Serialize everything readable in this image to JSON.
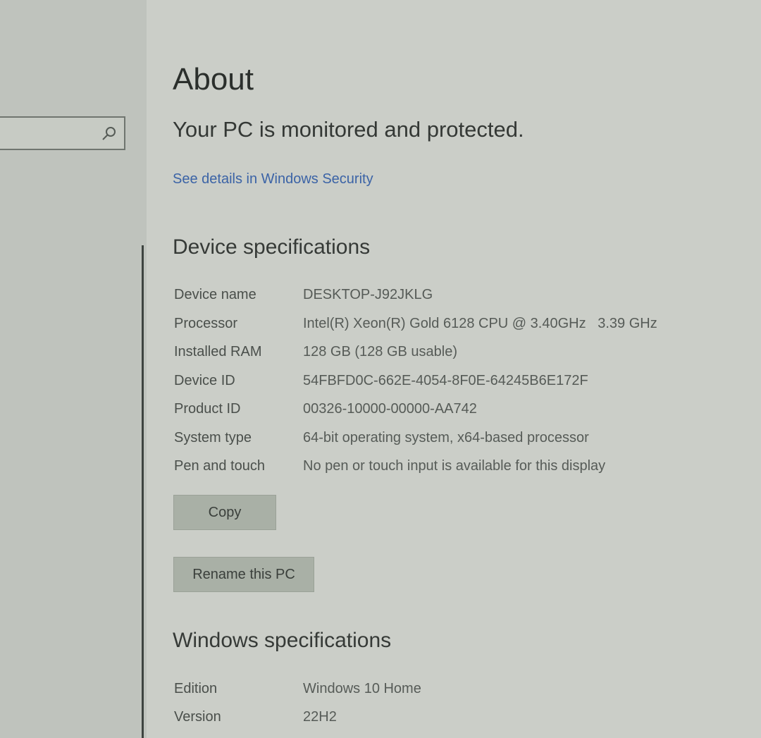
{
  "sidebar": {
    "search": {
      "value": "",
      "placeholder": ""
    }
  },
  "main": {
    "title": "About",
    "protection": {
      "status": "Your PC is monitored and protected.",
      "link": "See details in Windows Security"
    },
    "device_specs": {
      "heading": "Device specifications",
      "rows": [
        {
          "label": "Device name",
          "value": "DESKTOP-J92JKLG"
        },
        {
          "label": "Processor",
          "value": "Intel(R) Xeon(R) Gold 6128 CPU @ 3.40GHz   3.39 GHz"
        },
        {
          "label": "Installed RAM",
          "value": "128 GB (128 GB usable)"
        },
        {
          "label": "Device ID",
          "value": "54FBFD0C-662E-4054-8F0E-64245B6E172F"
        },
        {
          "label": "Product ID",
          "value": "00326-10000-00000-AA742"
        },
        {
          "label": "System type",
          "value": "64-bit operating system, x64-based processor"
        },
        {
          "label": "Pen and touch",
          "value": "No pen or touch input is available for this display"
        }
      ],
      "copy_label": "Copy",
      "rename_label": "Rename this PC"
    },
    "windows_specs": {
      "heading": "Windows specifications",
      "rows": [
        {
          "label": "Edition",
          "value": "Windows 10 Home"
        },
        {
          "label": "Version",
          "value": "22H2"
        }
      ]
    }
  },
  "colors": {
    "link": "#3b63a6",
    "background": "#cbcec8",
    "button": "#a9b0a6"
  },
  "icons": [
    "search-icon"
  ]
}
